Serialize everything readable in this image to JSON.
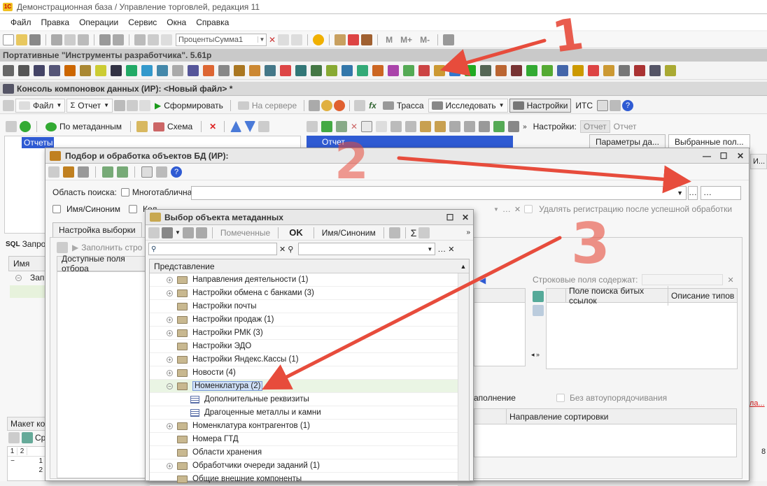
{
  "app": {
    "title": "Демонстрационная база / Управление торговлей, редакция 11"
  },
  "menu": [
    "Файл",
    "Правка",
    "Операции",
    "Сервис",
    "Окна",
    "Справка"
  ],
  "toolbar1": {
    "combo_value": "ПроцентыСумма1",
    "m_labels": [
      "M",
      "M+",
      "M-"
    ]
  },
  "portable_band": "Портативные \"Инструменты разработчика\". 5.61p",
  "console": {
    "title": "Консоль компоновок данных (ИР): <Новый файл> *",
    "toolbar": {
      "file": "Файл",
      "report": "Отчет",
      "generate": "Сформировать",
      "on_server": "На сервере",
      "trace": "Трасса",
      "investigate": "Исследовать",
      "settings": "Настройки",
      "its": "ИТС"
    },
    "left_toolbar": {
      "by_metadata": "По метаданным",
      "scheme": "Схема"
    },
    "tree_item": "Отчеты",
    "right_item": "Отчет",
    "settings_label": "Настройки:",
    "settings_opts": [
      "Отчет",
      "Отчет"
    ],
    "tabs": [
      "Параметры да...",
      "Выбранные пол..."
    ],
    "sql_tab": "Запро",
    "col_name": "Имя",
    "zapr": "Запр",
    "layout_label": "Макет ко",
    "sr_label": "Ср",
    "nums": [
      "1",
      "2"
    ],
    "right_col": "И...",
    "right_red": "кла...",
    "right_digit": "8"
  },
  "pick_dialog": {
    "title": "Подбор и обработка объектов БД (ИР):",
    "search_area_label": "Область поиска:",
    "multitable": "Многотабличная",
    "name_synonym": "Имя/Синоним",
    "kol": "Кол",
    "delete_registration": "Удалять регистрацию после успешной обработки",
    "tab_selection": "Настройка выборки",
    "fill_btn": "Заполнить стро",
    "avail_fields": "Доступные поля отбора",
    "string_fields_label": "Строковые поля содержат:",
    "grid_cols": [
      "Поле поиска битых ссылок",
      "Описание типов"
    ],
    "fill_label": "аполнение",
    "no_autoorder": "Без автоупорядочивания",
    "sort_col": "Направление сортировки"
  },
  "meta_dialog": {
    "title": "Выбор объекта метаданных",
    "toolbar": {
      "marked": "Помеченные",
      "ok": "OK",
      "name_syn": "Имя/Синоним"
    },
    "search_value": "",
    "column_header": "Представление",
    "rows": [
      {
        "label": "Направления деятельности (1)",
        "kind": "folder",
        "exp": "+"
      },
      {
        "label": "Настройки обмена с банками (3)",
        "kind": "folder",
        "exp": "+"
      },
      {
        "label": "Настройки почты",
        "kind": "folder",
        "exp": ""
      },
      {
        "label": "Настройки продаж (1)",
        "kind": "folder",
        "exp": "+"
      },
      {
        "label": "Настройки РМК (3)",
        "kind": "folder",
        "exp": "+"
      },
      {
        "label": "Настройки ЭДО",
        "kind": "folder",
        "exp": ""
      },
      {
        "label": "Настройки Яндекс.Кассы (1)",
        "kind": "folder",
        "exp": "+"
      },
      {
        "label": "Новости (4)",
        "kind": "folder",
        "exp": "+"
      },
      {
        "label": "Номенклатура (2)",
        "kind": "folder",
        "exp": "−",
        "selected": true
      },
      {
        "label": "Дополнительные реквизиты",
        "kind": "table",
        "exp": "",
        "child": true
      },
      {
        "label": "Драгоценные металлы и камни",
        "kind": "table",
        "exp": "",
        "child": true
      },
      {
        "label": "Номенклатура контрагентов (1)",
        "kind": "folder",
        "exp": "+"
      },
      {
        "label": "Номера ГТД",
        "kind": "folder",
        "exp": ""
      },
      {
        "label": "Области хранения",
        "kind": "folder",
        "exp": ""
      },
      {
        "label": "Обработчики очереди заданий (1)",
        "kind": "folder",
        "exp": "+"
      },
      {
        "label": "Общие внешние компоненты",
        "kind": "folder",
        "exp": ""
      }
    ]
  },
  "annotations": {
    "n1": "1",
    "n2": "2",
    "n3": "3"
  },
  "colors": {
    "accent_blue": "#2f5bd3",
    "selection": "#cfe0f7",
    "red": "#e74c3c",
    "green_play": "#1a9a1a"
  }
}
